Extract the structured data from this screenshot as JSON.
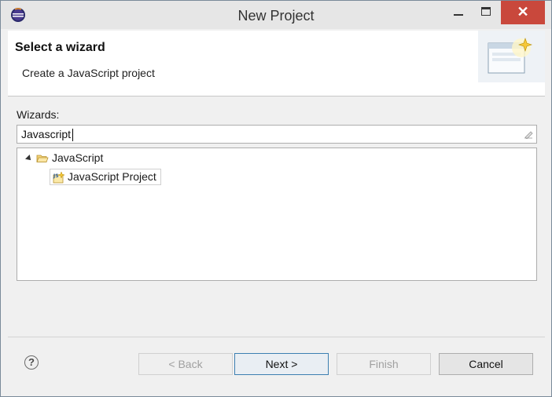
{
  "window": {
    "title": "New Project"
  },
  "banner": {
    "title": "Select a wizard",
    "description": "Create a JavaScript project"
  },
  "wizards": {
    "label": "Wizards:",
    "filter_value": "Javascript",
    "tree": [
      {
        "label": "JavaScript",
        "expanded": true,
        "children": [
          {
            "label": "JavaScript Project",
            "selected": true
          }
        ]
      }
    ]
  },
  "buttons": {
    "back": "< Back",
    "next": "Next >",
    "finish": "Finish",
    "cancel": "Cancel",
    "help": "?"
  },
  "icons": {
    "app": "eclipse-icon",
    "folder": "open-folder-icon",
    "project": "javascript-project-icon",
    "banner": "new-wizard-icon",
    "clear": "clear-filter-icon"
  }
}
